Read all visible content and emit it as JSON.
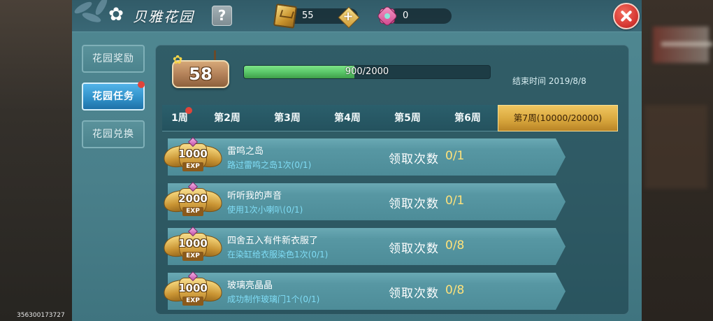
{
  "header": {
    "title": "贝雅花园",
    "title_icon": "flower-icon",
    "help_label": "?",
    "currencies": [
      {
        "icon": "gold-ticket-icon",
        "value": "55",
        "add_label": "+"
      },
      {
        "icon": "pink-flower-gem-icon",
        "value": "0"
      }
    ],
    "close_icon": "close-icon"
  },
  "sidebar": {
    "tabs": [
      {
        "label": "花园奖励",
        "active": false,
        "badge": false
      },
      {
        "label": "花园任务",
        "active": true,
        "badge": true
      },
      {
        "label": "花园兑换",
        "active": false,
        "badge": false
      }
    ]
  },
  "level": {
    "value": "58",
    "progress_text": "900/2000",
    "progress": 0.45
  },
  "end_time": "结束时间 2019/8/8",
  "week_tabs": [
    {
      "label": "1周",
      "active": false,
      "badge": true
    },
    {
      "label": "第2周",
      "active": false,
      "badge": false
    },
    {
      "label": "第3周",
      "active": false,
      "badge": false
    },
    {
      "label": "第4周",
      "active": false,
      "badge": false
    },
    {
      "label": "第5周",
      "active": false,
      "badge": false
    },
    {
      "label": "第6周",
      "active": false,
      "badge": false
    },
    {
      "label": "第7周(10000/20000)",
      "active": true,
      "badge": false
    }
  ],
  "tasks": {
    "exp_label": "EXP",
    "claim_label": "领取次数",
    "items": [
      {
        "exp": "1000",
        "title": "雷鸣之岛",
        "description": "路过雷鸣之岛1次(0/1)",
        "claims": "0/1"
      },
      {
        "exp": "2000",
        "title": "听听我的声音",
        "description": "使用1次小喇叭(0/1)",
        "claims": "0/1"
      },
      {
        "exp": "1000",
        "title": "四舍五入有件新衣服了",
        "description": "在染缸给衣服染色1次(0/1)",
        "claims": "0/8"
      },
      {
        "exp": "1000",
        "title": "玻璃亮晶晶",
        "description": "成功制作玻璃门1个(0/1)",
        "claims": "0/8"
      }
    ]
  },
  "device_id": "356300173727",
  "colors": {
    "gold": "#d9a83e",
    "progress_green": "#5bc86a",
    "active_tab_blue": "#2f8fc7",
    "close_red": "#d83a34",
    "notification_dot": "#e0443a",
    "claim_value": "#ffe27a",
    "description_text": "#7fdcf5"
  }
}
